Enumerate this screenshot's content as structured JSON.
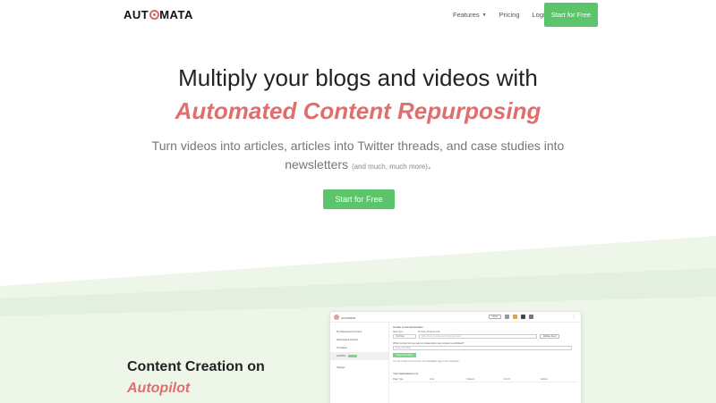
{
  "nav": {
    "logo_pre": "AUT",
    "logo_post": "MATA",
    "links": [
      "Features",
      "Pricing",
      "Login"
    ],
    "cta": "Start for Free"
  },
  "hero": {
    "title": "Multiply your blogs and videos with",
    "accent": "Automated Content Repurposing",
    "subtitle": "Turn videos into articles, articles into Twitter threads, and case studies into newsletters",
    "subtitle_small": "(and much, much more)",
    "subtitle_end": ".",
    "cta": "Start for Free"
  },
  "section": {
    "title": "Content Creation on",
    "accent": "Autopilot"
  },
  "mockup": {
    "brand": "AUTOMATA",
    "header_button": "Home",
    "menu": "⋮",
    "sidebar": [
      "My Repurposed Content",
      "Repurposed Content",
      "Templates",
      "AutoPilot",
      "Settings"
    ],
    "main_title": "Create a new Automation",
    "label_type": "Start Type",
    "label_url": "YouTube Channel Link",
    "select_value": "YouTube",
    "url_placeholder": "https://www.youtube.com/c/channel-name",
    "check_button": "Validate Feed",
    "question": "Which content do you want to create when new content is published?",
    "question_placeholder": "Select Template",
    "create_button": "Save Automation",
    "note_pre": "You can create new ones from your",
    "note_link": "Templates",
    "note_post": "page in the workspace",
    "list_title": "Your Automations (1)",
    "table_headers": [
      "Page Type",
      "Link",
      "Outputs",
      "Out Of",
      "Actions"
    ]
  },
  "colors": {
    "accent_red": "#e06e6e",
    "cta_green": "#5cc46b",
    "band_green": "#e8f3e4"
  }
}
